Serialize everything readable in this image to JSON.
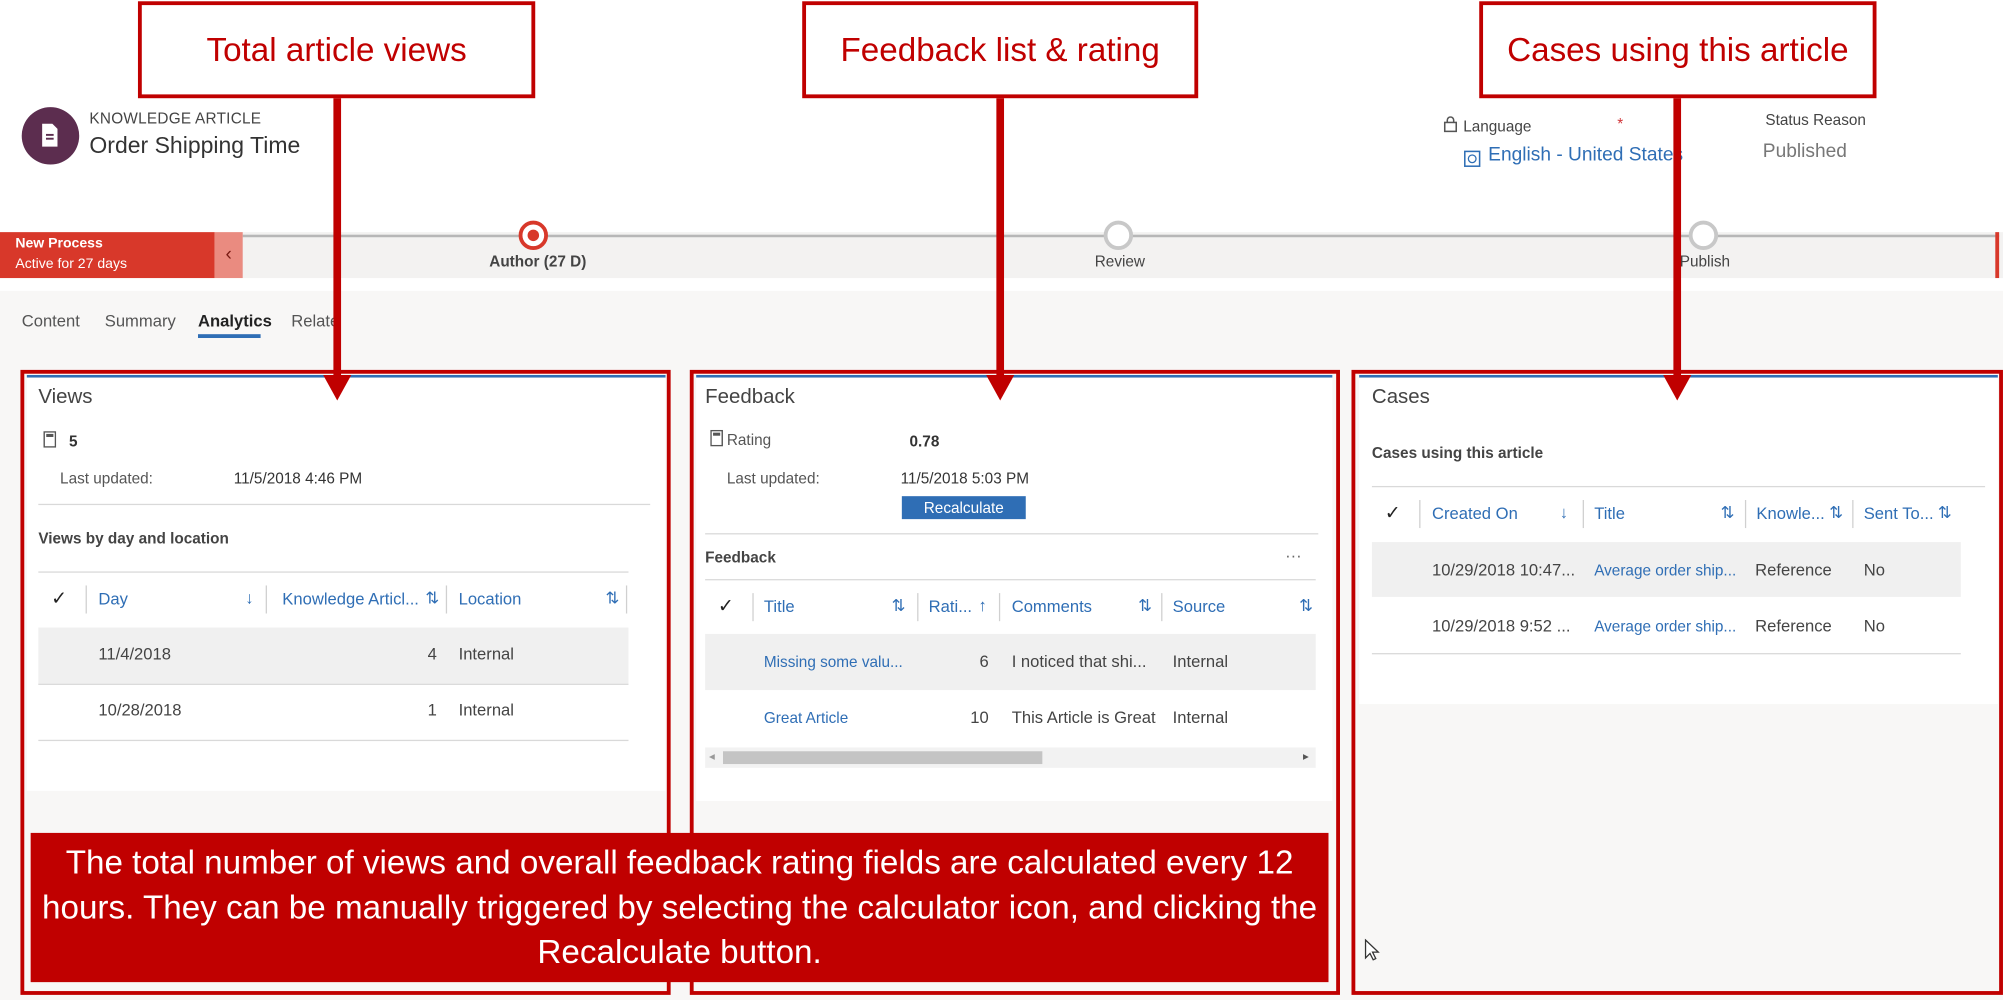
{
  "record": {
    "entity_type": "KNOWLEDGE ARTICLE",
    "title": "Order Shipping Time",
    "language_label": "Language",
    "required_mark": "*",
    "language_value": "English - United States",
    "status_reason_label": "Status Reason",
    "status_reason_value": "Published"
  },
  "process": {
    "name": "New Process",
    "active_for": "Active for 27 days",
    "collapse_glyph": "‹",
    "stages": [
      {
        "label": "Author  (27 D)",
        "active": true
      },
      {
        "label": "Review",
        "active": false
      },
      {
        "label": "Publish",
        "active": false
      }
    ]
  },
  "tabs": [
    "Content",
    "Summary",
    "Analytics",
    "Relate"
  ],
  "views_panel": {
    "title": "Views",
    "count": "5",
    "last_updated_label": "Last updated:",
    "last_updated_value": "11/5/2018 4:46 PM",
    "subgrid_title": "Views by day and location",
    "columns": [
      "Day",
      "Knowledge Articl...",
      "Location"
    ],
    "rows": [
      [
        "11/4/2018",
        "4",
        "Internal"
      ],
      [
        "10/28/2018",
        "1",
        "Internal"
      ]
    ]
  },
  "feedback_panel": {
    "title": "Feedback",
    "rating_label": "Rating",
    "rating_value": "0.78",
    "last_updated_label": "Last updated:",
    "last_updated_value": "11/5/2018 5:03 PM",
    "recalculate_label": "Recalculate",
    "subgrid_title": "Feedback",
    "more_glyph": "···",
    "columns": [
      "Title",
      "Rati...",
      "Comments",
      "Source"
    ],
    "rows": [
      [
        "Missing some valu...",
        "6",
        "I noticed that shi...",
        "Internal"
      ],
      [
        "Great Article",
        "10",
        "This Article is Great",
        "Internal"
      ]
    ]
  },
  "cases_panel": {
    "title": "Cases",
    "subgrid_title": "Cases using this article",
    "columns": [
      "Created On",
      "Title",
      "Knowle...",
      "Sent To..."
    ],
    "rows": [
      [
        "10/29/2018 10:47...",
        "Average order ship...",
        "Reference",
        "No"
      ],
      [
        "10/29/2018 9:52 ...",
        "Average order ship...",
        "Reference",
        "No"
      ]
    ]
  },
  "annotations": {
    "callout_views": "Total article views",
    "callout_feedback": "Feedback list & rating",
    "callout_cases": "Cases using this article",
    "note": "The total number of views and overall feedback rating fields are calculated every 12 hours.  They can be manually triggered by selecting the calculator icon, and clicking the Recalculate button."
  },
  "colors": {
    "annotation_red": "#c00000",
    "process_red": "#d8382a",
    "accent_blue": "#2f6eb5",
    "avatar_purple": "#5c2d4f"
  }
}
